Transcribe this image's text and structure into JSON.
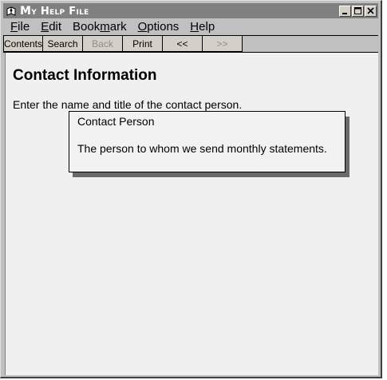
{
  "window": {
    "title": "My Help File",
    "controls": {
      "minimize": "_",
      "maximize": "□",
      "close": "×"
    }
  },
  "menu": {
    "items": [
      {
        "label": "File",
        "mnemonic": "F"
      },
      {
        "label": "Edit",
        "mnemonic": "E"
      },
      {
        "label": "Bookmark",
        "mnemonic": "m"
      },
      {
        "label": "Options",
        "mnemonic": "O"
      },
      {
        "label": "Help",
        "mnemonic": "H"
      }
    ]
  },
  "toolbar": {
    "contents": "Contents",
    "search": "Search",
    "back": "Back",
    "print": "Print",
    "prev": "<<",
    "next": ">>"
  },
  "content": {
    "heading": "Contact Information",
    "body_prefix": "Enter the name and title of the ",
    "link_text": "contact person",
    "body_suffix": "."
  },
  "popup": {
    "title": "Contact Person",
    "description": "The person to whom we send monthly statements."
  },
  "colors": {
    "titlebar": "#808080",
    "content_bg": "#f0f0f0",
    "window_bg": "#c0c0c0"
  },
  "icons": {
    "app": "help-book-icon",
    "minimize": "minimize-icon",
    "maximize": "maximize-icon",
    "close": "close-icon"
  }
}
